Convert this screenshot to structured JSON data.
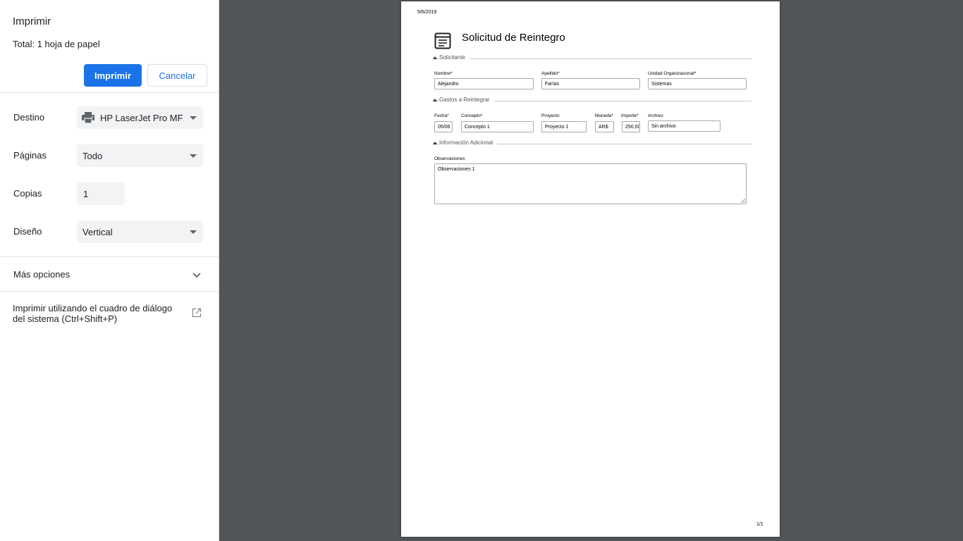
{
  "panel": {
    "title": "Imprimir",
    "total_prefix": "Total: ",
    "total_value": "1 hoja de papel",
    "print_button": "Imprimir",
    "cancel_button": "Cancelar",
    "destination": {
      "label": "Destino",
      "value": "HP LaserJet Pro MF",
      "icon": "printer-icon"
    },
    "pages": {
      "label": "Páginas",
      "value": "Todo"
    },
    "copies": {
      "label": "Copias",
      "value": "1"
    },
    "layout": {
      "label": "Diseño",
      "value": "Vertical"
    },
    "more_options": "Más opciones",
    "system_dialog": "Imprimir utilizando el cuadro de diálogo del sistema (Ctrl+Shift+P)"
  },
  "preview": {
    "date": "5/6/2019",
    "page_number": "1/1",
    "title": "Solicitud de Reintegro",
    "sections": {
      "applicant": "Solicitante",
      "expenses": "Gastos a Reintegrar",
      "additional": "Información Adicional"
    },
    "applicant": {
      "name_label": "Nombre*",
      "name_value": "Alejandro",
      "surname_label": "Apellido*",
      "surname_value": "Farías",
      "unit_label": "Unidad Organizacional*",
      "unit_value": "Sistemas"
    },
    "expenses": {
      "date_label": "Fecha*",
      "date_value": "05/06",
      "concept_label": "Concepto*",
      "concept_value": "Concepto 1",
      "project_label": "Proyecto",
      "project_value": "Proyecto 1",
      "currency_label": "Moneda*",
      "currency_value": "AR$",
      "amount_label": "Importe*",
      "amount_value": "250,00",
      "file_label": "Archivo",
      "file_value": "Sin archivo"
    },
    "additional": {
      "notes_label": "Observaciones",
      "notes_value": "Observaciones 1"
    }
  },
  "colors": {
    "accent": "#1a73e8",
    "preview_bg": "#525659",
    "field_bg": "#f1f3f4"
  }
}
